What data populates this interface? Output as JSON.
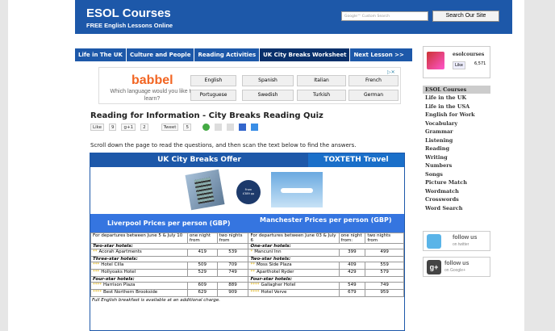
{
  "header": {
    "title": "ESOL Courses",
    "subtitle": "FREE English Lessons Online",
    "search_placeholder": "Google™ Custom Search",
    "search_button": "Search Our Site"
  },
  "nav": [
    "Life in The UK",
    "Culture and People",
    "Reading Activities",
    "UK City Breaks Worksheet",
    "Next Lesson >>"
  ],
  "ad": {
    "brand": "babbel",
    "tagline": "Which language would you like to learn?",
    "languages": [
      "English",
      "Spanish",
      "Italian",
      "French",
      "Portuguese",
      "Swedish",
      "Turkish",
      "German"
    ],
    "close": "▷✕"
  },
  "page_title": "Reading for Information - City Breaks Reading Quiz",
  "share": {
    "like": "Like",
    "like_count": "9",
    "gplus": "g+1",
    "gplus_count": "2",
    "tweet": "Tweet",
    "tweet_count": "5"
  },
  "intro": "Scroll down the page to read the questions, and then scan the text below to find the answers.",
  "offer": {
    "title": "UK City Breaks Offer",
    "agency": "TOXTETH Travel",
    "badge_line1": "From",
    "badge_line2": "£389 pp",
    "liverpool_header": "Liverpool   Prices per person (GBP)",
    "manchester_header": "Manchester   Prices per person (GBP)",
    "colhead": {
      "liv_dates": "For departures between June 5 &  July 10",
      "one_night": "one night from",
      "two_nights_l": "two nights from",
      "man_dates": "For departures between June 03 & July 6",
      "one_night_r": "one night from:",
      "two_nights_r": "two nights from"
    },
    "sections": [
      {
        "left_cat": "Two-star hotels:",
        "right_cat": "One-star hotels:",
        "rows": [
          {
            "ls": "**",
            "l": "Acorah Apartments",
            "l1": "419",
            "l2": "539",
            "rs": "*",
            "r": "Mancuni Inn",
            "r1": "399",
            "r2": "499"
          }
        ]
      },
      {
        "left_cat": "Three-star hotels:",
        "right_cat": "Two-star hotels:",
        "rows": [
          {
            "ls": "***",
            "l": "Hotel Cilla",
            "l1": "509",
            "l2": "709",
            "rs": "**",
            "r": "Moss Side Plaza",
            "r1": "409",
            "r2": "559"
          },
          {
            "ls": "***",
            "l": "Hollyoaks Hotel",
            "l1": "529",
            "l2": "749",
            "rs": "**",
            "r": "Aparthotel Ryder",
            "r1": "429",
            "r2": "579"
          }
        ]
      },
      {
        "left_cat": "Four-star hotels:",
        "right_cat": "Four-star hotels:",
        "rows": [
          {
            "ls": "****",
            "l": "Harrison Plaza",
            "l1": "609",
            "l2": "889",
            "rs": "****",
            "r": "Gallagher Hotel",
            "r1": "549",
            "r2": "749"
          },
          {
            "ls": "****",
            "l": "Best Northern Brookside",
            "l1": "629",
            "l2": "909",
            "rs": "****",
            "r": "Hotel Verve",
            "r1": "679",
            "r2": "959"
          }
        ]
      }
    ],
    "note": "Full English breakfast is available at an additional charge."
  },
  "facebook": {
    "name": "esolcourses",
    "like": "Like",
    "count": "6,571"
  },
  "sidenav": {
    "header": "ESOL Courses",
    "items": [
      "Life in the UK",
      "Life in the USA",
      "English for Work",
      "Vocabulary",
      "Grammar",
      "Listening",
      "Reading",
      "Writing",
      "Numbers",
      "Songs",
      "Picture Match",
      "Wordmatch",
      "Crosswords",
      "Word Search"
    ]
  },
  "twitter": {
    "line1": "follow us",
    "line2": "on twitter"
  },
  "googleplus": {
    "line1": "follow us",
    "line2": "on Google+"
  }
}
